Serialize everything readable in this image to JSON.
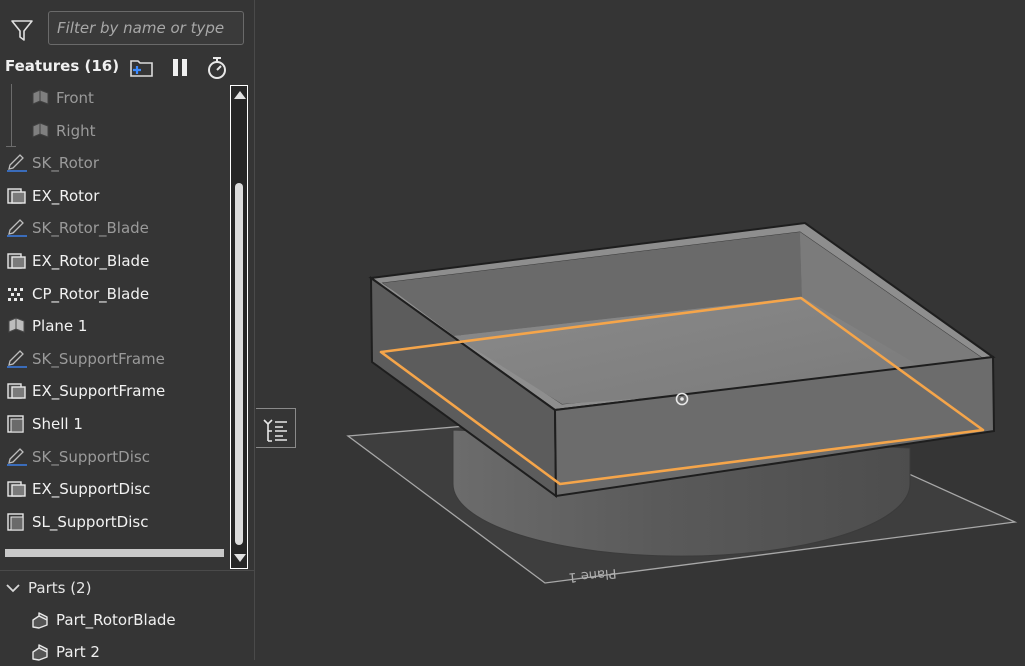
{
  "filter": {
    "placeholder": "Filter by name or type",
    "icon": "filter-icon"
  },
  "features": {
    "title": "Features (16)",
    "tools": [
      "new-folder-icon",
      "pause-icon",
      "stopwatch-icon"
    ],
    "items": [
      {
        "label": "Front",
        "icon": "plane-icon",
        "state": "dim"
      },
      {
        "label": "Right",
        "icon": "plane-icon",
        "state": "dim"
      },
      {
        "label": "SK_Rotor",
        "icon": "sketch-icon",
        "state": "dim"
      },
      {
        "label": "EX_Rotor",
        "icon": "extrude-icon",
        "state": "bright"
      },
      {
        "label": "SK_Rotor_Blade",
        "icon": "sketch-icon",
        "state": "dim"
      },
      {
        "label": "EX_Rotor_Blade",
        "icon": "extrude-icon",
        "state": "bright"
      },
      {
        "label": "CP_Rotor_Blade",
        "icon": "pattern-icon",
        "state": "bright"
      },
      {
        "label": "Plane 1",
        "icon": "plane-icon",
        "state": "bright"
      },
      {
        "label": "SK_SupportFrame",
        "icon": "sketch-icon",
        "state": "dim"
      },
      {
        "label": "EX_SupportFrame",
        "icon": "extrude-icon",
        "state": "bright"
      },
      {
        "label": "Shell 1",
        "icon": "shell-icon",
        "state": "bright"
      },
      {
        "label": "SK_SupportDisc",
        "icon": "sketch-icon",
        "state": "dim"
      },
      {
        "label": "EX_SupportDisc",
        "icon": "extrude-icon",
        "state": "bright"
      },
      {
        "label": "SL_SupportDisc",
        "icon": "shell-icon",
        "state": "bright"
      }
    ]
  },
  "parts": {
    "title": "Parts (2)",
    "items": [
      {
        "label": "Part_RotorBlade",
        "icon": "part-icon"
      },
      {
        "label": "Part 2",
        "icon": "part-icon"
      }
    ]
  },
  "viewport": {
    "plane_label": "Plane 1",
    "highlight_color": "#f5a54a",
    "background_color": "#353535"
  }
}
